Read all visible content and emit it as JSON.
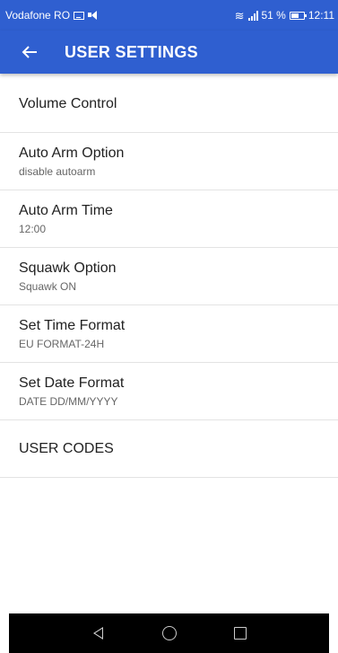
{
  "status_bar": {
    "carrier": "Vodafone RO",
    "signal_text": "51 %",
    "time": "12:11",
    "icons": [
      "message-icon",
      "volume-icon",
      "wifi-icon",
      "signal-icon",
      "battery-icon"
    ],
    "background": "#2f5fd0"
  },
  "app_bar": {
    "title": "USER SETTINGS",
    "back_icon": "arrow-left-icon",
    "background": "#2f5fd0"
  },
  "settings": {
    "items": [
      {
        "title": "Volume Control",
        "subtitle": ""
      },
      {
        "title": "Auto Arm Option",
        "subtitle": "disable autoarm"
      },
      {
        "title": "Auto Arm Time",
        "subtitle": "12:00"
      },
      {
        "title": "Squawk Option",
        "subtitle": "Squawk ON"
      },
      {
        "title": "Set Time Format",
        "subtitle": "EU FORMAT-24H"
      },
      {
        "title": "Set Date Format",
        "subtitle": "DATE DD/MM/YYYY"
      },
      {
        "title": "USER CODES",
        "subtitle": ""
      }
    ]
  },
  "nav_bar": {
    "buttons": [
      "back-triangle-icon",
      "home-circle-icon",
      "recent-apps-icon"
    ]
  }
}
